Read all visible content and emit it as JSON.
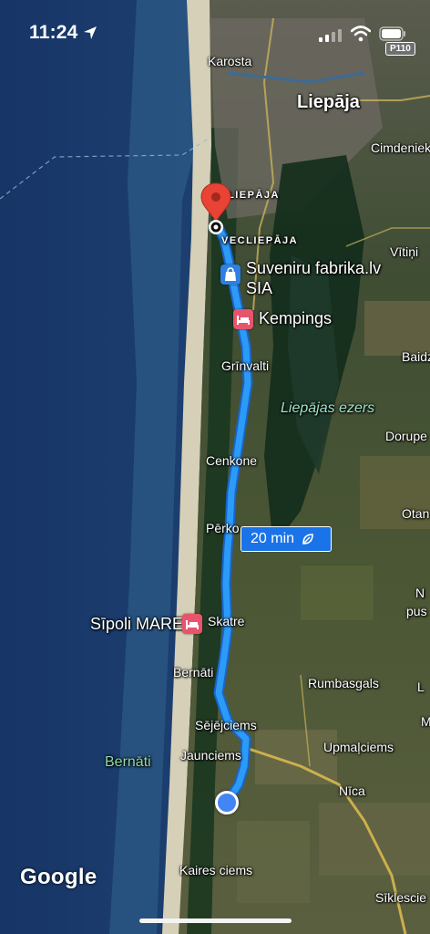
{
  "status_bar": {
    "time": "11:24"
  },
  "map": {
    "road_badge": "P110",
    "colors": {
      "sea_deep": "#1a3b6f",
      "sea_shallow": "#2d5b8a",
      "beach": "#d8d2bd",
      "forest": "#163a22",
      "farmland": "#4b5a35",
      "route": "#2b9bf7",
      "route_outline": "#1a64c8",
      "pin": "#e84335"
    },
    "labels": {
      "karosta": "Karosta",
      "liepaja": "Liepāja",
      "cimdenieki": "Cimdeniek",
      "liepaja_small": "LIEPĀJA",
      "vecliepaja": "VECLIEPĀJA",
      "vitini": "Vītiņi",
      "baidi": "Baidz",
      "dorupe": "Dorupe",
      "grinvalti": "Grīnvalti",
      "cenkone": "Cenkone",
      "perkone": "Pērko",
      "otan": "Otan",
      "n": "N",
      "pus": "pus",
      "skatre": "Skatre",
      "bernati_village": "Bernāti",
      "rumbasgals": "Rumbasgals",
      "sejejciems": "Sējējciems",
      "upmalciems": "Upmaļciems",
      "jaunciems": "Jaunciems",
      "nica": "Nīca",
      "bernati_park": "Bernāti",
      "kaires_ciems": "Kaires ciems",
      "siklescie": "Sīklescie",
      "lake": "Liepājas ezers",
      "l_edge": "L",
      "m_edge": "M"
    },
    "pois": {
      "suveniru": "Suveniru fabrika.lv\nSIA",
      "suveniru_line1": "Suveniru fabrika.lv",
      "suveniru_line2": "SIA",
      "kempings": "Kempings",
      "sipoli": "Sīpoli MARE"
    },
    "route_time": "20 min",
    "brand": "Google"
  }
}
